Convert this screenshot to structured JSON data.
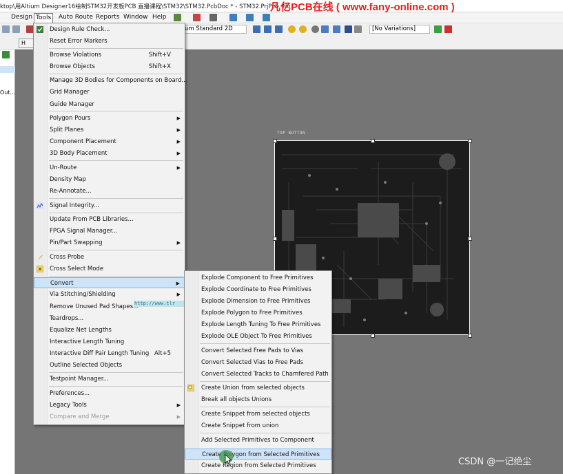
{
  "title_bar": {
    "path": "ktop\\用Altium Designer16绘制STM32开发板PCB 直播课程\\STM32\\STM32.PcbDoc * - STM32.PrjPcb. No",
    "brand": "凡亿PCB在线 ( www.fany-online.com )"
  },
  "menubar": {
    "items": [
      "Design",
      "Tools",
      "Auto Route",
      "Reports",
      "Window",
      "Help"
    ]
  },
  "toolbar": {
    "view_combo": "um Standard 2D",
    "variations_combo": "[No Variations]"
  },
  "doc_tab": {
    "label": "H"
  },
  "left_panel": {
    "rows": [
      "Out...",
      "",
      "",
      ""
    ]
  },
  "pcb": {
    "layer_label": "TOP BOTTON"
  },
  "tools_menu": {
    "items": [
      {
        "label": "Design Rule Check...",
        "shortcut": "",
        "submenu": false
      },
      {
        "label": "Reset Error Markers",
        "shortcut": "",
        "submenu": false
      },
      {
        "label": "Browse Violations",
        "shortcut": "Shift+V",
        "submenu": false
      },
      {
        "label": "Browse Objects",
        "shortcut": "Shift+X",
        "submenu": false
      },
      {
        "label": "Manage 3D Bodies for Components on Board...",
        "shortcut": "",
        "submenu": false
      },
      {
        "label": "Grid Manager",
        "shortcut": "",
        "submenu": false
      },
      {
        "label": "Guide Manager",
        "shortcut": "",
        "submenu": false
      },
      {
        "label": "Polygon Pours",
        "shortcut": "",
        "submenu": true
      },
      {
        "label": "Split Planes",
        "shortcut": "",
        "submenu": true
      },
      {
        "label": "Component Placement",
        "shortcut": "",
        "submenu": true
      },
      {
        "label": "3D Body Placement",
        "shortcut": "",
        "submenu": true
      },
      {
        "label": "Un-Route",
        "shortcut": "",
        "submenu": true
      },
      {
        "label": "Density Map",
        "shortcut": "",
        "submenu": false
      },
      {
        "label": "Re-Annotate...",
        "shortcut": "",
        "submenu": false
      },
      {
        "label": "Signal Integrity...",
        "shortcut": "",
        "submenu": false
      },
      {
        "label": "Update From PCB Libraries...",
        "shortcut": "",
        "submenu": false
      },
      {
        "label": "FPGA Signal Manager...",
        "shortcut": "",
        "submenu": false
      },
      {
        "label": "Pin/Part Swapping",
        "shortcut": "",
        "submenu": true
      },
      {
        "label": "Cross Probe",
        "shortcut": "",
        "submenu": false
      },
      {
        "label": "Cross Select Mode",
        "shortcut": "",
        "submenu": false
      },
      {
        "label": "Convert",
        "shortcut": "",
        "submenu": true
      },
      {
        "label": "Via Stitching/Shielding",
        "shortcut": "",
        "submenu": true
      },
      {
        "label": "Remove Unused Pad Shapes...",
        "shortcut": "",
        "submenu": false
      },
      {
        "label": "Teardrops...",
        "shortcut": "",
        "submenu": false
      },
      {
        "label": "Equalize Net Lengths",
        "shortcut": "",
        "submenu": false
      },
      {
        "label": "Interactive Length Tuning",
        "shortcut": "",
        "submenu": false
      },
      {
        "label": "Interactive Diff Pair Length Tuning",
        "shortcut": "Alt+5",
        "submenu": false
      },
      {
        "label": "Outline Selected Objects",
        "shortcut": "",
        "submenu": false
      },
      {
        "label": "Testpoint Manager...",
        "shortcut": "",
        "submenu": false
      },
      {
        "label": "Preferences...",
        "shortcut": "",
        "submenu": false
      },
      {
        "label": "Legacy Tools",
        "shortcut": "",
        "submenu": true
      },
      {
        "label": "Compare and Merge",
        "shortcut": "",
        "submenu": true
      }
    ]
  },
  "url_badge": "http://www.tlr",
  "convert_menu": {
    "items": [
      {
        "label": "Explode Component to Free Primitives"
      },
      {
        "label": "Explode Coordinate to Free Primitives"
      },
      {
        "label": "Explode Dimension to Free Primitives"
      },
      {
        "label": "Explode Polygon to Free Primitives"
      },
      {
        "label": "Explode Length Tuning To Free Primitives"
      },
      {
        "label": "Explode OLE Object To Free Primitives"
      },
      {
        "label": "Convert Selected Free Pads to Vias"
      },
      {
        "label": "Convert Selected Vias to Free Pads"
      },
      {
        "label": "Convert Selected Tracks to Chamfered Path"
      },
      {
        "label": "Create Union from selected objects"
      },
      {
        "label": "Break all objects Unions"
      },
      {
        "label": "Create Snippet from selected objects"
      },
      {
        "label": "Create Snippet from union"
      },
      {
        "label": "Add Selected Primitives to Component"
      },
      {
        "label": "Create Polygon from Selected Primitives"
      },
      {
        "label": "Create Region from Selected Primitives"
      }
    ]
  },
  "watermark": "CSDN @一记绝尘",
  "colors": {
    "highlight": "#cde3f7",
    "highlight_border": "#7eb4ea",
    "canvas": "#757575",
    "board": "#1c1c1c",
    "brand": "#e82020"
  }
}
